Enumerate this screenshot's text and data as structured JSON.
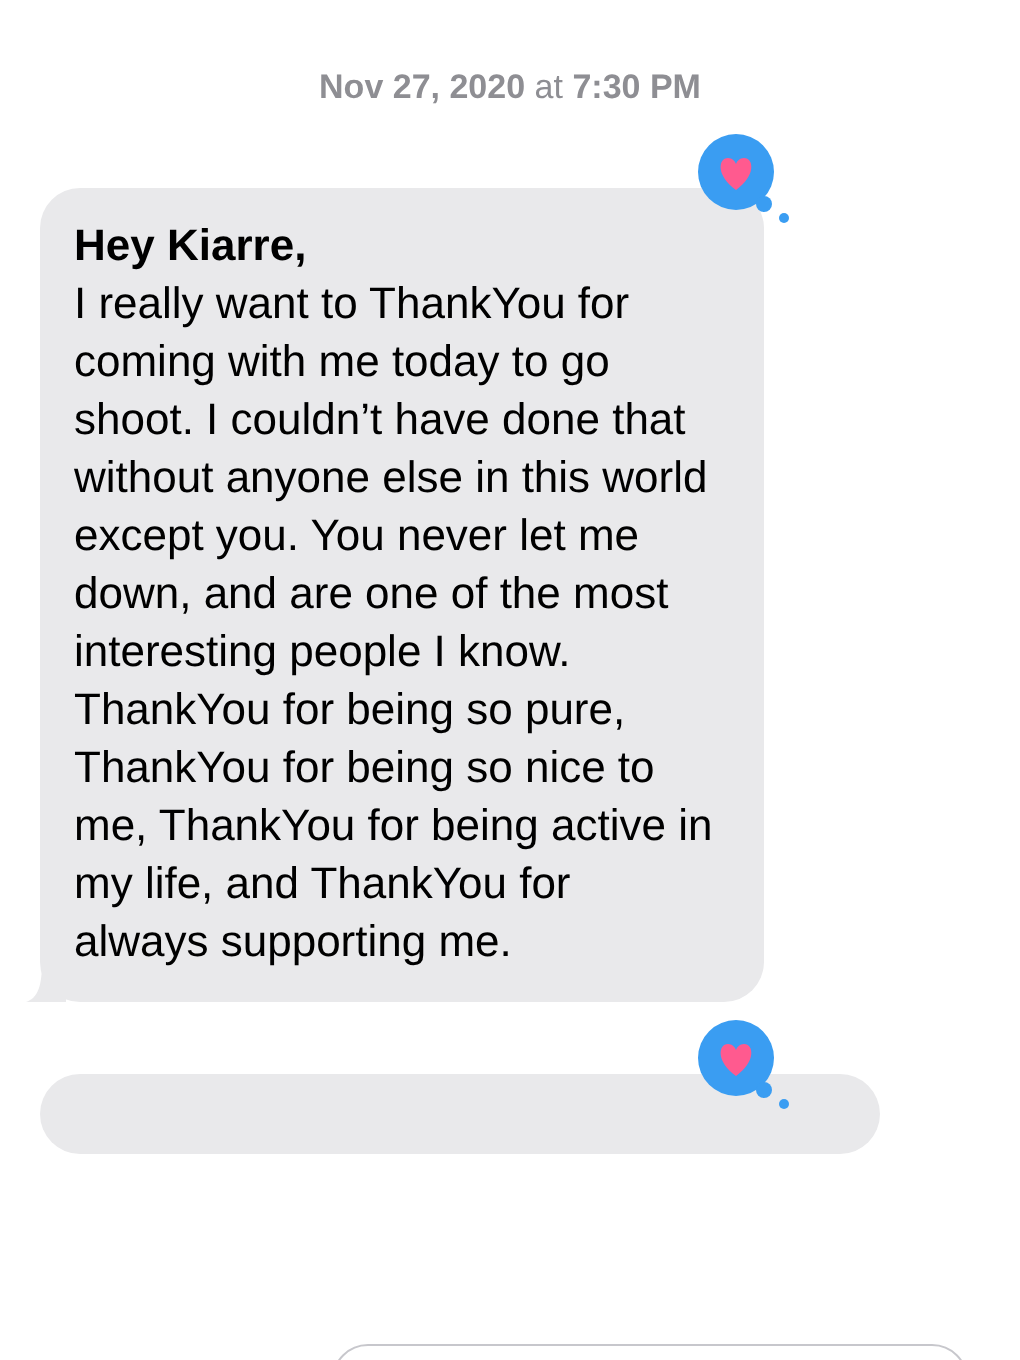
{
  "timestamp": {
    "date": "Nov 27, 2020",
    "at": "at",
    "time": "7:30 PM"
  },
  "messages": [
    {
      "text": "**Hey Kiarre,**\nI really want to ThankYou for coming with me today to go shoot. I couldn’t have done that without anyone else in this world except you. You never let me down, and are one of the most interesting people I know. ThankYou for being so pure, ThankYou for being so nice to me, ThankYou for being active in my life, and ThankYou for always supporting me.",
      "heart_reaction": true
    },
    {
      "heart_reaction": true
    }
  ]
}
